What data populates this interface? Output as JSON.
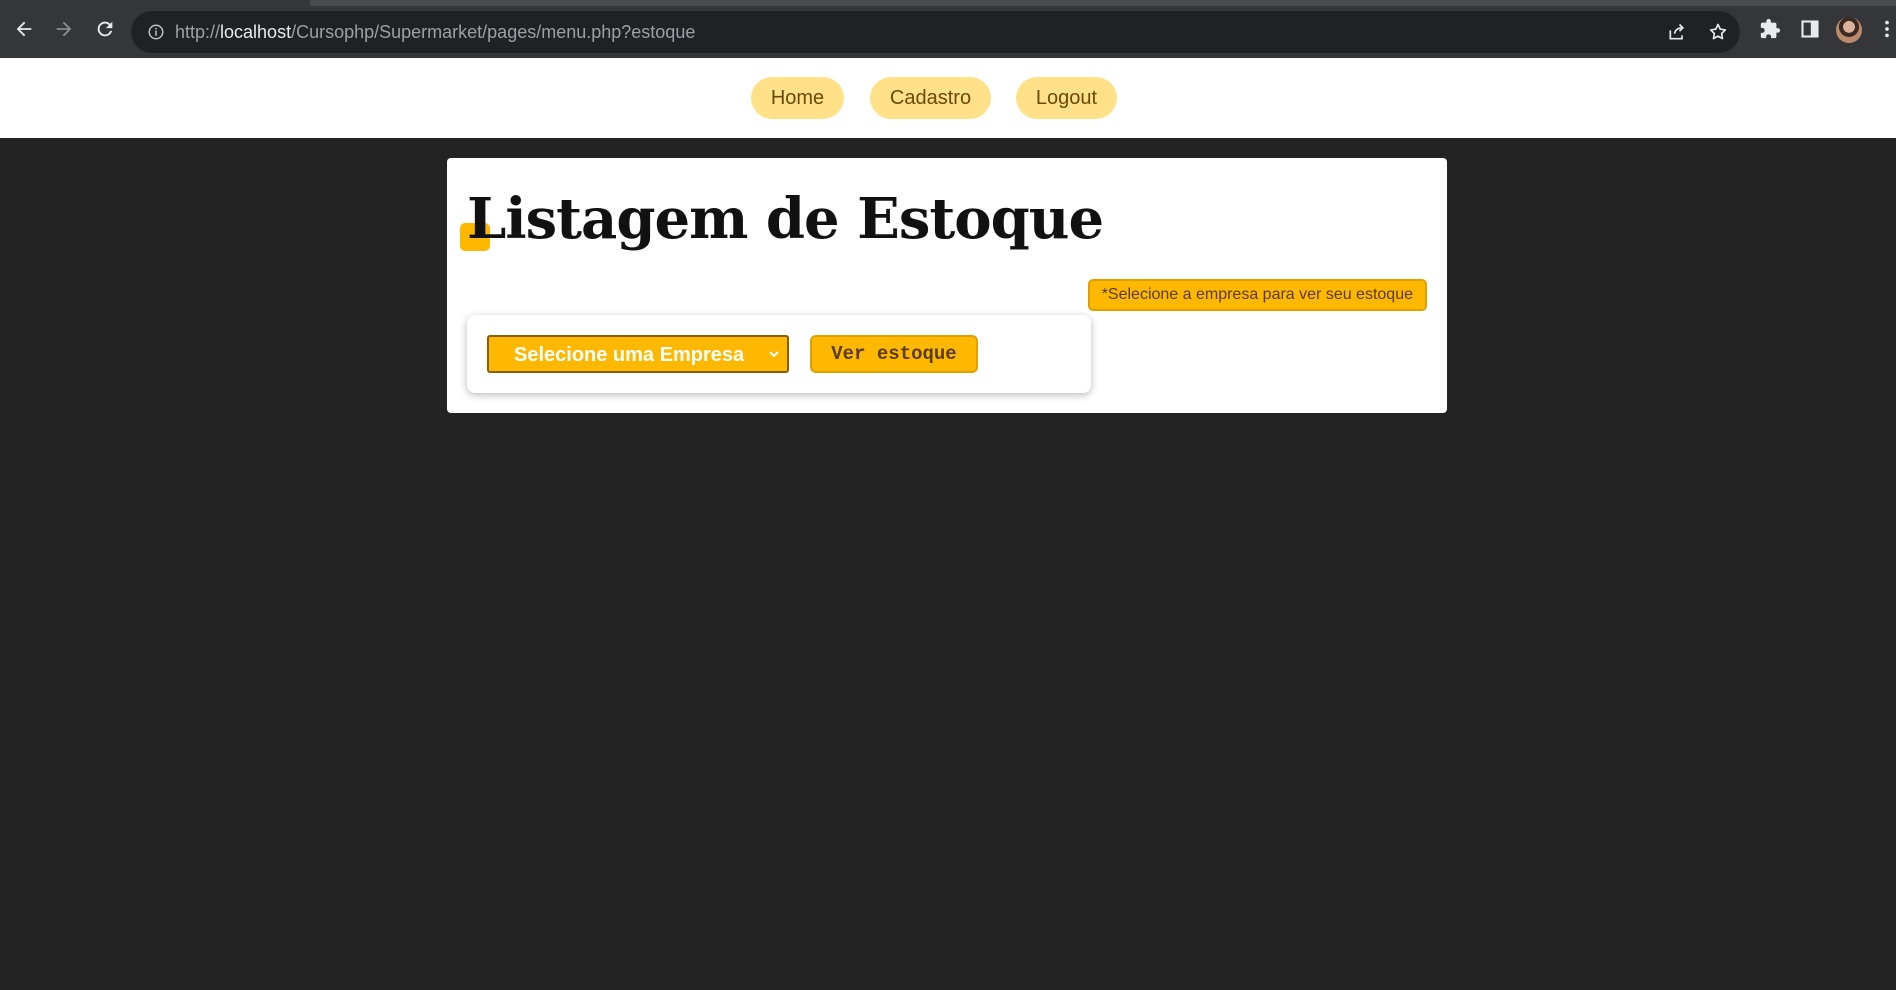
{
  "browser": {
    "url_prefix": "http://",
    "url_host": "localhost",
    "url_path": "/Cursophp/Supermarket/pages/menu.php?estoque",
    "icons": [
      "back-icon",
      "forward-icon",
      "reload-icon",
      "info-icon",
      "share-icon",
      "star-icon",
      "extensions-icon",
      "side-panel-icon",
      "avatar",
      "menu-icon"
    ]
  },
  "nav": {
    "items": [
      {
        "label": "Home"
      },
      {
        "label": "Cadastro"
      },
      {
        "label": "Logout"
      }
    ]
  },
  "main": {
    "title": "Listagem de Estoque",
    "hint": "*Selecione a empresa para ver seu estoque",
    "select": {
      "selected": "Selecione uma Empresa"
    },
    "button_label": "Ver estoque"
  },
  "colors": {
    "page_background": "#232323",
    "accent": "#ffb800",
    "nav_pill": "#ffe18a",
    "card": "#ffffff"
  }
}
